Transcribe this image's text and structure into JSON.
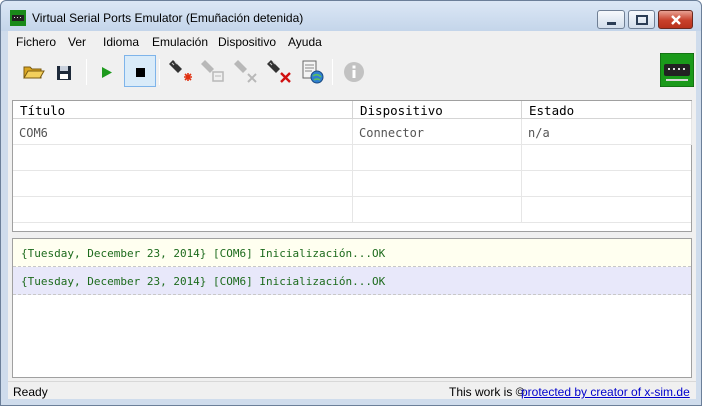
{
  "window": {
    "title": "Virtual Serial Ports Emulator (Emuñación detenida)",
    "icon": "serial-port-app-icon"
  },
  "menu": [
    {
      "label": "Fichero"
    },
    {
      "label": "Ver"
    },
    {
      "label": "Idioma"
    },
    {
      "label": "Emulación"
    },
    {
      "label": "Dispositivo"
    },
    {
      "label": "Ayuda"
    }
  ],
  "toolbar": {
    "buttons": [
      {
        "icon": "open-folder-icon"
      },
      {
        "icon": "save-disk-icon"
      },
      {
        "icon": "play-icon"
      },
      {
        "icon": "stop-icon",
        "pressed": true
      },
      {
        "icon": "new-device-icon"
      },
      {
        "icon": "edit-device-icon",
        "disabled": true
      },
      {
        "icon": "disable-device-icon",
        "disabled": true
      },
      {
        "icon": "delete-device-icon"
      },
      {
        "icon": "settings-globe-icon"
      },
      {
        "icon": "info-icon",
        "disabled": true
      }
    ]
  },
  "devices": {
    "columns": [
      "Título",
      "Dispositivo",
      "Estado"
    ],
    "rows": [
      {
        "title": "COM6",
        "device": "Connector",
        "state": "n/a"
      }
    ]
  },
  "log": [
    {
      "text": "{Tuesday, December 23, 2014} [COM6] Inicialización...OK",
      "bg": "#fffff0"
    },
    {
      "text": "{Tuesday, December 23, 2014} [COM6] Inicialización...OK",
      "bg": "#e8e8fa"
    }
  ],
  "status": {
    "left": "Ready",
    "right": "This work is ©",
    "link": "protected by creator of x-sim.de"
  },
  "colors": {
    "log_text": "#1d6b1d",
    "link": "#0000cc",
    "selection": "#d9ebf9"
  }
}
